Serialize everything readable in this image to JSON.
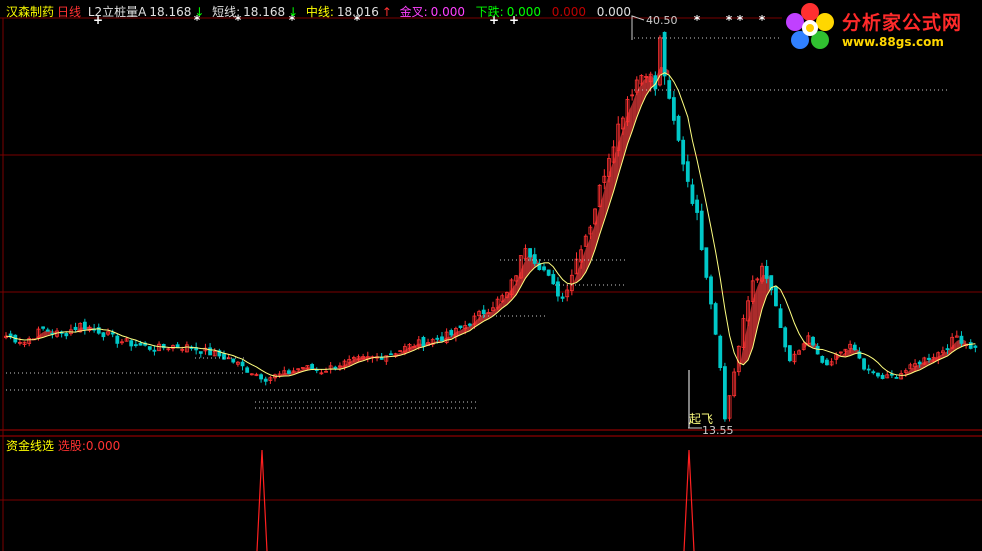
{
  "header": {
    "stock_name": "汉森制药",
    "period": "日线",
    "l2_label": "L2立桩量A",
    "l2_value": "18.168",
    "l2_arrow": "↓",
    "short_label": "短线:",
    "short_value": "18.168",
    "short_arrow": "↓",
    "mid_label": "中线:",
    "mid_value": "18.016",
    "mid_arrow": "↑",
    "golden_label": "金叉:",
    "golden_value": "0.000",
    "drop_label": "下跌:",
    "drop_value": "0.000",
    "extra_value_1": "0.000",
    "extra_value_2": "0.000"
  },
  "indicator": {
    "name": "资金线选",
    "select_label": "选股:",
    "select_value": "0.000"
  },
  "annotations": {
    "high_label": "40.50",
    "low_label": "13.55",
    "takeoff_label": "起飞"
  },
  "logo": {
    "title": "分析家公式网",
    "url": "www.88gs.com"
  },
  "colors": {
    "background": "#000000",
    "up": "#ff3232",
    "down": "#00c8c8",
    "band": "#c83232",
    "midline": "#ffff80",
    "grid": "#7a0000",
    "signal": "#ff2020",
    "header_yellow": "#ffff00",
    "header_magenta": "#ff40ff",
    "header_green": "#00ff00"
  },
  "chart_data": {
    "type": "candlestick",
    "y_range_estimate": [
      13.0,
      42.0
    ],
    "high": 40.5,
    "low": 13.55,
    "price_path": [
      [
        0,
        19.5
      ],
      [
        4,
        19.1
      ],
      [
        8,
        20.0
      ],
      [
        12,
        19.6
      ],
      [
        16,
        20.3
      ],
      [
        20,
        19.9
      ],
      [
        24,
        19.2
      ],
      [
        28,
        18.9
      ],
      [
        32,
        18.6
      ],
      [
        36,
        18.8
      ],
      [
        40,
        18.7
      ],
      [
        44,
        18.3
      ],
      [
        48,
        17.9
      ],
      [
        52,
        17.1
      ],
      [
        56,
        16.5
      ],
      [
        60,
        16.8
      ],
      [
        64,
        17.3
      ],
      [
        68,
        17.0
      ],
      [
        72,
        17.5
      ],
      [
        76,
        17.8
      ],
      [
        80,
        18.0
      ],
      [
        84,
        18.4
      ],
      [
        88,
        18.9
      ],
      [
        92,
        19.2
      ],
      [
        96,
        19.6
      ],
      [
        100,
        20.5
      ],
      [
        104,
        21.5
      ],
      [
        108,
        22.5
      ],
      [
        110,
        24.0
      ],
      [
        112,
        26.0
      ],
      [
        114,
        25.0
      ],
      [
        116,
        24.2
      ],
      [
        118,
        23.0
      ],
      [
        120,
        22.2
      ],
      [
        122,
        24.0
      ],
      [
        124,
        26.0
      ],
      [
        126,
        27.5
      ],
      [
        128,
        30.0
      ],
      [
        130,
        32.5
      ],
      [
        132,
        34.5
      ],
      [
        134,
        36.5
      ],
      [
        136,
        37.8
      ],
      [
        138,
        38.6
      ],
      [
        140,
        37.2
      ],
      [
        141,
        40.5
      ],
      [
        143,
        36.0
      ],
      [
        146,
        32.0
      ],
      [
        149,
        28.0
      ],
      [
        152,
        22.0
      ],
      [
        154,
        17.5
      ],
      [
        155,
        13.55
      ],
      [
        157,
        17.0
      ],
      [
        159,
        20.5
      ],
      [
        161,
        23.5
      ],
      [
        163,
        24.2
      ],
      [
        165,
        22.8
      ],
      [
        167,
        20.0
      ],
      [
        169,
        17.5
      ],
      [
        171,
        18.5
      ],
      [
        173,
        19.4
      ],
      [
        175,
        18.0
      ],
      [
        177,
        17.2
      ],
      [
        179,
        18.0
      ],
      [
        181,
        18.8
      ],
      [
        183,
        18.5
      ],
      [
        185,
        17.2
      ],
      [
        187,
        16.8
      ],
      [
        189,
        16.5
      ],
      [
        191,
        16.6
      ],
      [
        193,
        16.9
      ],
      [
        195,
        17.2
      ],
      [
        197,
        17.7
      ],
      [
        199,
        18.0
      ],
      [
        201,
        18.3
      ],
      [
        203,
        18.8
      ],
      [
        205,
        19.5
      ],
      [
        207,
        19.0
      ],
      [
        209,
        18.6
      ]
    ],
    "signal_bars": [
      57,
      155
    ]
  }
}
